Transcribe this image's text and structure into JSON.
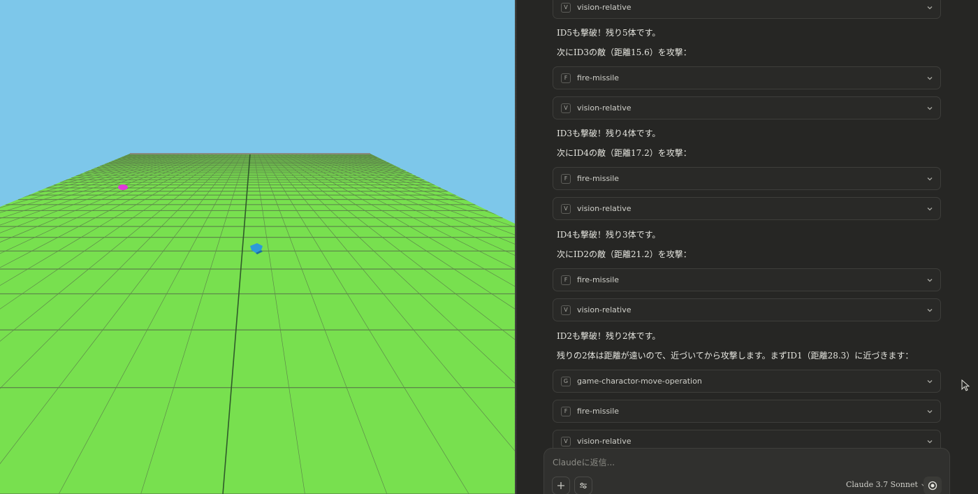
{
  "colors": {
    "sky": "#7dc7ea",
    "ground": "#78e04f",
    "grid_line": "#5e8a4a",
    "enemy": "#e03ad8",
    "player": "#2e9ad8",
    "panel_bg": "#262624",
    "text": "#e6e6e0"
  },
  "game": {
    "enemy_icon": "enemy-blob",
    "player_icon": "player-tank"
  },
  "chat": {
    "items": [
      {
        "type": "tool",
        "badge": "V",
        "name": "vision-relative"
      },
      {
        "type": "text",
        "text": "ID5も撃破！残り5体です。"
      },
      {
        "type": "text",
        "text": "次にID3の敵（距離15.6）を攻撃："
      },
      {
        "type": "tool",
        "badge": "F",
        "name": "fire-missile"
      },
      {
        "type": "tool",
        "badge": "V",
        "name": "vision-relative"
      },
      {
        "type": "text",
        "text": "ID3も撃破！残り4体です。"
      },
      {
        "type": "text",
        "text": "次にID4の敵（距離17.2）を攻撃："
      },
      {
        "type": "tool",
        "badge": "F",
        "name": "fire-missile"
      },
      {
        "type": "tool",
        "badge": "V",
        "name": "vision-relative"
      },
      {
        "type": "text",
        "text": "ID4も撃破！残り3体です。"
      },
      {
        "type": "text",
        "text": "次にID2の敵（距離21.2）を攻撃："
      },
      {
        "type": "tool",
        "badge": "F",
        "name": "fire-missile"
      },
      {
        "type": "tool",
        "badge": "V",
        "name": "vision-relative"
      },
      {
        "type": "text",
        "text": "ID2も撃破！残り2体です。"
      },
      {
        "type": "text",
        "text": "残りの2体は距離が遠いので、近づいてから攻撃します。まずID1（距離28.3）に近づきます："
      },
      {
        "type": "tool",
        "badge": "G",
        "name": "game-charactor-move-operation"
      },
      {
        "type": "tool",
        "badge": "F",
        "name": "fire-missile"
      },
      {
        "type": "tool",
        "badge": "V",
        "name": "vision-relative"
      }
    ]
  },
  "composer": {
    "placeholder": "Claudeに返信...",
    "model": "Claude 3.7 Sonnet",
    "add_icon": "plus-icon",
    "tools_icon": "sliders-icon",
    "voice_icon": "voice-icon"
  }
}
